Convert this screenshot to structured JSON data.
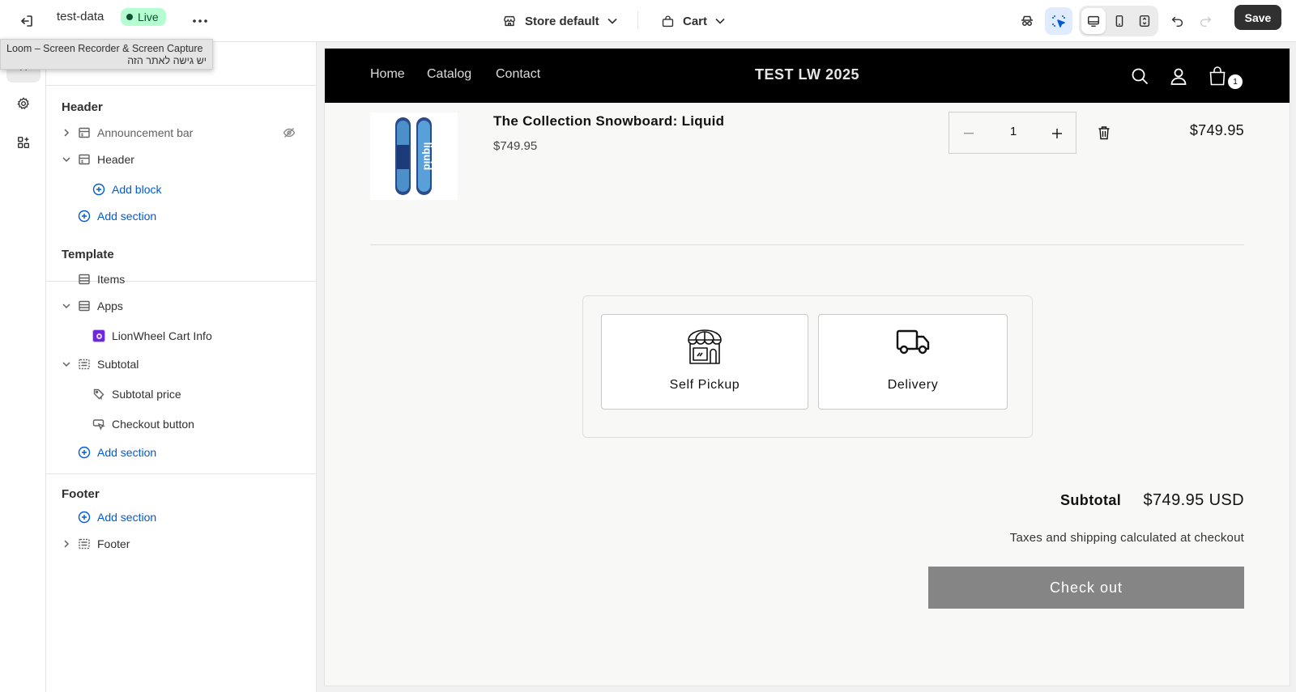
{
  "topbar": {
    "store_name": "test-data",
    "status": "Live",
    "theme_select": "Store default",
    "page_select": "Cart",
    "save_label": "Save"
  },
  "tooltip": {
    "line1": "Loom – Screen Recorder & Screen Capture",
    "line2": "יש גישה לאתר הזה"
  },
  "sidebar": {
    "header": {
      "title": "Header",
      "items": [
        {
          "label": "Announcement bar",
          "icon": "section-icon",
          "hidden": true
        },
        {
          "label": "Header",
          "icon": "section-icon",
          "expanded": true
        },
        {
          "label": "Add block",
          "icon": "plus-circle-icon"
        },
        {
          "label": "Add section",
          "icon": "plus-circle-icon"
        }
      ]
    },
    "template": {
      "title": "Template",
      "items": [
        {
          "label": "Items",
          "icon": "section-icon"
        },
        {
          "label": "Apps",
          "icon": "section-icon",
          "expanded": true
        },
        {
          "label": "LionWheel Cart Info",
          "icon": "app-icon"
        },
        {
          "label": "Subtotal",
          "icon": "section-icon",
          "expanded": true
        },
        {
          "label": "Subtotal price",
          "icon": "price-tag-icon"
        },
        {
          "label": "Checkout button",
          "icon": "button-cursor-icon"
        },
        {
          "label": "Add section",
          "icon": "plus-circle-icon"
        }
      ]
    },
    "footer": {
      "title": "Footer",
      "items": [
        {
          "label": "Add section",
          "icon": "plus-circle-icon"
        },
        {
          "label": "Footer",
          "icon": "section-icon",
          "expanded": false
        }
      ]
    }
  },
  "store": {
    "nav": [
      "Home",
      "Catalog",
      "Contact"
    ],
    "logo": "TEST LW 2025",
    "cart_count": "1",
    "product": {
      "title": "The Collection Snowboard: Liquid",
      "price": "$749.95",
      "quantity": "1",
      "line_total": "$749.95",
      "image_text": "liquid"
    },
    "shipping": {
      "options": [
        "Self Pickup",
        "Delivery"
      ]
    },
    "subtotal_label": "Subtotal",
    "subtotal_value": "$749.95 USD",
    "tax_note": "Taxes and shipping calculated at checkout",
    "checkout_label": "Check out"
  },
  "colors": {
    "accent_link": "#005bd3",
    "live_badge_bg": "#b4fed2",
    "live_badge_text": "#0c5132",
    "checkout_bg": "#858585",
    "store_header_bg": "#000000"
  }
}
